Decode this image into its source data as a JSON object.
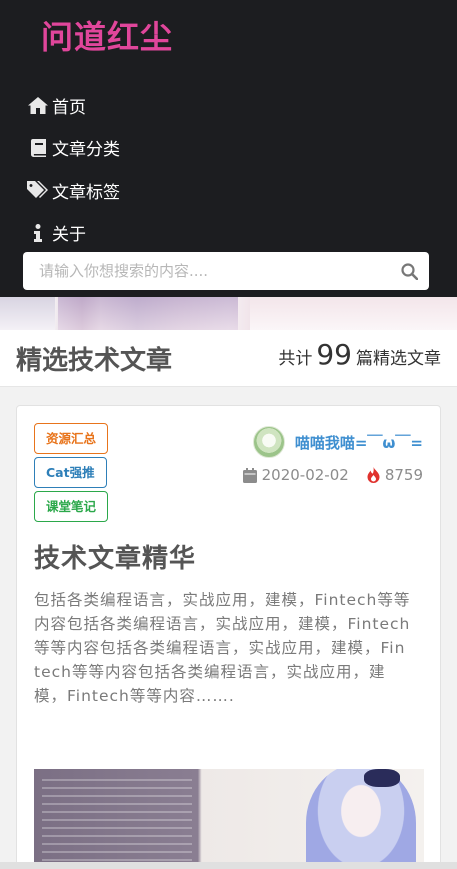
{
  "nav": {
    "brand": "问道红尘",
    "items": [
      {
        "label": "首页",
        "icon": "home-icon"
      },
      {
        "label": "文章分类",
        "icon": "book-icon"
      },
      {
        "label": "文章标签",
        "icon": "tags-icon"
      },
      {
        "label": "关于",
        "icon": "info-icon"
      }
    ],
    "search": {
      "placeholder": "请输入你想搜索的内容....",
      "value": "",
      "icon": "search-icon"
    }
  },
  "section": {
    "title": "精选技术文章",
    "count_prefix": "共计",
    "count": "99",
    "count_suffix": "篇精选文章"
  },
  "article": {
    "tags": [
      "资源汇总",
      "Cat强推",
      "课堂笔记"
    ],
    "author": "喵喵我喵=￣ω￣=",
    "date": "2020-02-02",
    "views": "8759",
    "title": "技术文章精华",
    "excerpt": "包括各类编程语言，实战应用，建模，Fintech等等内容包括各类编程语言，实战应用，建模，Fintech等等内容包括各类编程语言，实战应用，建模，Fintech等等内容包括各类编程语言，实战应用，建模，Fintech等等内容……."
  },
  "colors": {
    "nav_bg": "#1c1d20",
    "brand": "#e0469b",
    "tag_orange": "#e8741b",
    "tag_blue": "#2e7fb8",
    "tag_green": "#2ba84a",
    "author": "#3f8fd0",
    "fire": "#e0322e"
  }
}
